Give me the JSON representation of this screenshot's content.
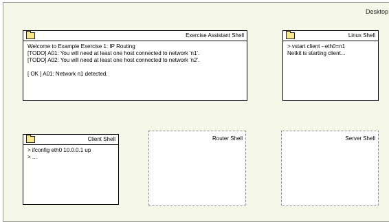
{
  "desktop": {
    "label": "Desktop"
  },
  "windows": {
    "exercise": {
      "title": "Exercise Assistant Shell",
      "lines": [
        "Welcome to Example Exercise 1: IP Routing",
        "[TODO] A01: You will need at least one host connected to network 'n1'.",
        "[TODO] A02: You will need at least one host connected to network 'n2'.",
        "",
        "[ OK ] A01: Network n1 detected."
      ]
    },
    "linux": {
      "title": "Linux Shell",
      "lines": [
        "> vstart client --eth0=n1",
        "Netkit is starting client..."
      ]
    },
    "client": {
      "title": "Client Shell",
      "lines": [
        "> ifconfig eth0 10.0.0.1 up",
        "> ..."
      ]
    },
    "router": {
      "title": "Router Shell"
    },
    "server": {
      "title": "Server Shell"
    }
  }
}
